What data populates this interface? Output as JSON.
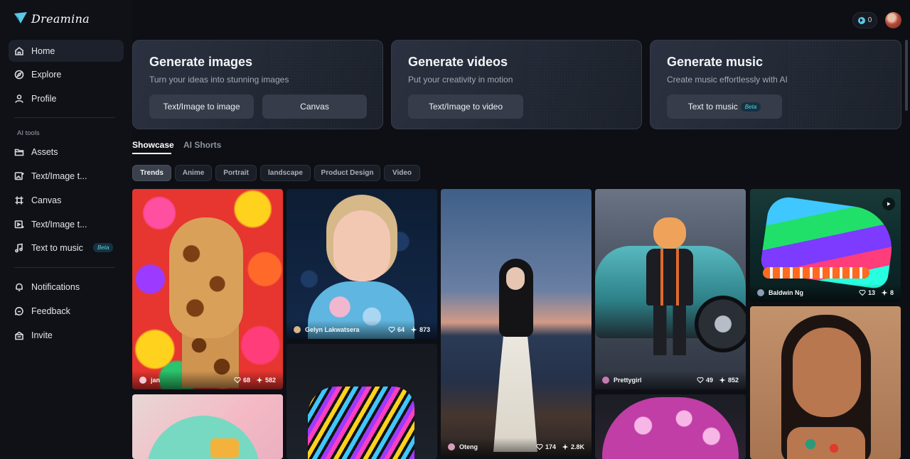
{
  "brand": {
    "name": "Dreamina"
  },
  "sidebar": {
    "items": [
      {
        "label": "Home",
        "icon": "home-icon",
        "active": true
      },
      {
        "label": "Explore",
        "icon": "compass-icon"
      },
      {
        "label": "Profile",
        "icon": "user-icon"
      }
    ],
    "section_label": "AI tools",
    "tools": [
      {
        "label": "Assets",
        "icon": "folder-icon"
      },
      {
        "label": "Text/Image t...",
        "icon": "image-gen-icon"
      },
      {
        "label": "Canvas",
        "icon": "canvas-icon"
      },
      {
        "label": "Text/Image t...",
        "icon": "video-gen-icon"
      },
      {
        "label": "Text to music",
        "icon": "music-icon",
        "badge": "Beta"
      }
    ],
    "bottom": [
      {
        "label": "Notifications",
        "icon": "bell-icon"
      },
      {
        "label": "Feedback",
        "icon": "chat-icon"
      },
      {
        "label": "Invite",
        "icon": "gift-icon"
      }
    ]
  },
  "topbar": {
    "credits": "0"
  },
  "hero": [
    {
      "title": "Generate images",
      "subtitle": "Turn your ideas into stunning images",
      "buttons": [
        "Text/Image to image",
        "Canvas"
      ]
    },
    {
      "title": "Generate videos",
      "subtitle": "Put your creativity in motion",
      "buttons": [
        "Text/Image to video"
      ]
    },
    {
      "title": "Generate music",
      "subtitle": "Create music effortlessly with AI",
      "buttons": [
        "Text to music"
      ],
      "badge": "Beta"
    }
  ],
  "tabs": [
    "Showcase",
    "AI Shorts"
  ],
  "chips": [
    "Trends",
    "Anime",
    "Portrait",
    "landscape",
    "Product Design",
    "Video"
  ],
  "gallery": [
    {
      "author": "jan",
      "likes": "68",
      "remixes": "582"
    },
    {
      "author": "Gelyn Lakwatsera",
      "likes": "64",
      "remixes": "873"
    },
    {
      "author": "Oteng",
      "likes": "174",
      "remixes": "2.8K"
    },
    {
      "author": "Prettygirl",
      "likes": "49",
      "remixes": "852"
    },
    {
      "author": "Baldwin Ng",
      "likes": "13",
      "remixes": "8"
    }
  ],
  "colors": {
    "background": "#0d0f14",
    "accent": "#62c9e6"
  }
}
